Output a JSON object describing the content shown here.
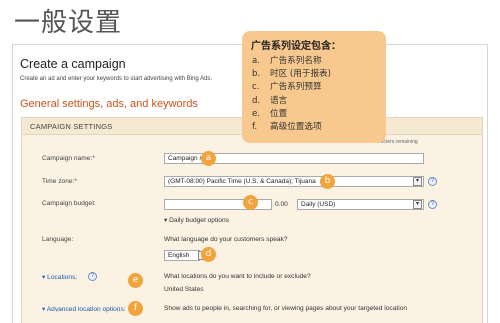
{
  "slide": {
    "title": "一般设置"
  },
  "screenshot": {
    "title": "Create a campaign",
    "subtitle": "Create an ad and enter your keywords to start advertising with Bing Ads.",
    "section_heading": "General settings, ads, and keywords"
  },
  "panel": {
    "header": "CAMPAIGN SETTINGS",
    "chars_remaining": "89 characters remaining",
    "campaign_name": {
      "label": "Campaign name:*",
      "value": "Campaign #1"
    },
    "time_zone": {
      "label": "Time zone:*",
      "value": "(GMT-08:00) Pacific Time (U.S. & Canada); Tijuana"
    },
    "campaign_budget": {
      "label": "Campaign budget:",
      "amount": "0.00",
      "period": "Daily (USD)",
      "options_link": "Daily budget options"
    },
    "language": {
      "label": "Language:",
      "question": "What language do your customers speak?",
      "value": "English"
    },
    "locations": {
      "label": "Locations:",
      "question": "What locations do you want to include or exclude?",
      "value": "United States"
    },
    "advanced_location": {
      "label": "Advanced location options:",
      "text": "Show ads to people in, searching for, or viewing pages about your targeted location"
    }
  },
  "callout": {
    "title": "广告系列设定包含：",
    "items": [
      {
        "marker": "a.",
        "text": "广告系列名称"
      },
      {
        "marker": "b.",
        "text": "时区 (用于报表)"
      },
      {
        "marker": "c.",
        "text": "广告系列预算"
      },
      {
        "marker": "d.",
        "text": "语言"
      },
      {
        "marker": "e.",
        "text": "位置"
      },
      {
        "marker": "f.",
        "text": "高级位置选项"
      }
    ]
  },
  "badges": [
    "a",
    "b",
    "c",
    "d",
    "e",
    "f"
  ],
  "colors": {
    "badge": "#f0a43b",
    "callout": "#f8c98f",
    "section_heading": "#c7541c",
    "panel": "#fbf2e3",
    "link": "#1a5aa6"
  },
  "icons": [
    "help-icon",
    "dropdown-arrow-icon",
    "expand-arrow-icon"
  ]
}
